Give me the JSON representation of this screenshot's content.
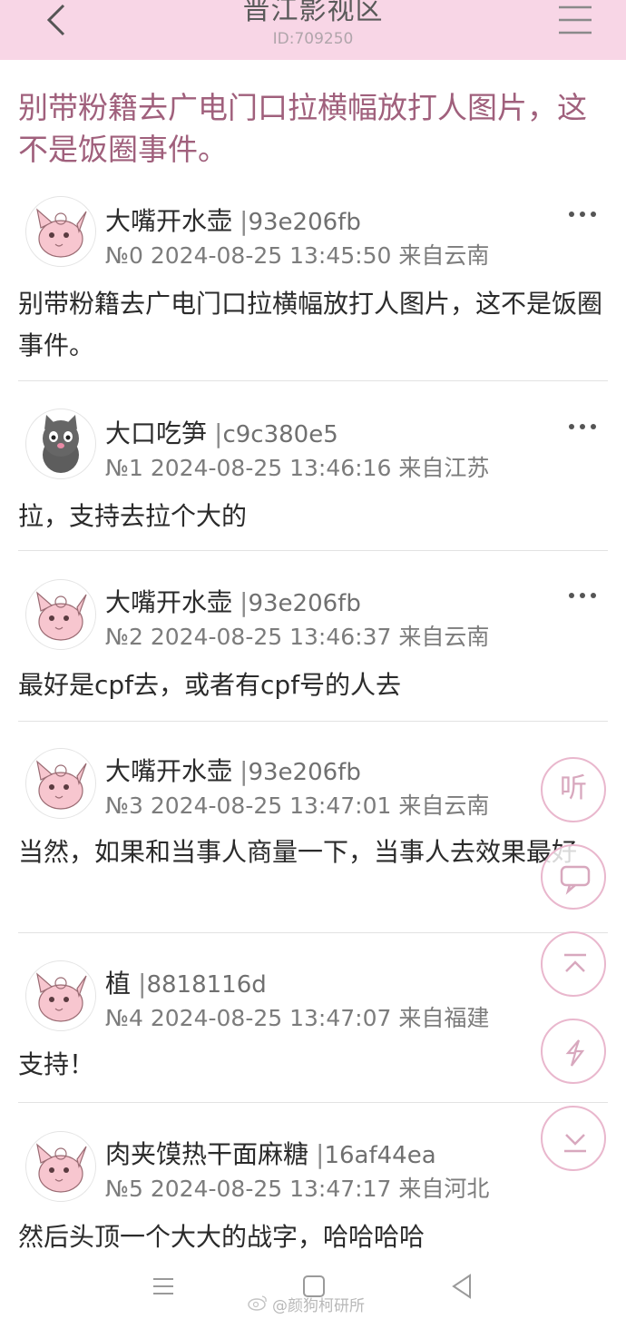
{
  "header": {
    "title": "晋江影视区",
    "id_label": "ID:709250",
    "back_icon": "chevron-left-icon",
    "menu_icon": "hamburger-menu-icon"
  },
  "thread": {
    "title": "别带粉籍去广电门口拉横幅放打人图片，这不是饭圈事件。"
  },
  "posts": [
    {
      "username": "大嘴开水壶",
      "user_id": "93e206fb",
      "floor": "№0",
      "datetime": "2024-08-25 13:45:50",
      "location": "来自云南",
      "content": "别带粉籍去广电门口拉横幅放打人图片，这不是饭圈事件。",
      "avatar": "pink-creature-avatar"
    },
    {
      "username": "大口吃笋",
      "user_id": "c9c380e5",
      "floor": "№1",
      "datetime": "2024-08-25 13:46:16",
      "location": "来自江苏",
      "content": "拉，支持去拉个大的",
      "avatar": "gray-cat-avatar"
    },
    {
      "username": "大嘴开水壶",
      "user_id": "93e206fb",
      "floor": "№2",
      "datetime": "2024-08-25 13:46:37",
      "location": "来自云南",
      "content": "最好是cpf去，或者有cpf号的人去",
      "avatar": "pink-creature-avatar"
    },
    {
      "username": "大嘴开水壶",
      "user_id": "93e206fb",
      "floor": "№3",
      "datetime": "2024-08-25 13:47:01",
      "location": "来自云南",
      "content": "当然，如果和当事人商量一下，当事人去效果最好",
      "avatar": "pink-creature-avatar"
    },
    {
      "username": "植",
      "user_id": "8818116d",
      "floor": "№4",
      "datetime": "2024-08-25 13:47:07",
      "location": "来自福建",
      "content": "支持！",
      "avatar": "pink-creature-avatar"
    },
    {
      "username": "肉夹馍热干面麻糖",
      "user_id": "16af44ea",
      "floor": "№5",
      "datetime": "2024-08-25 13:47:17",
      "location": "来自河北",
      "content": "然后头顶一个大大的战字，哈哈哈哈",
      "avatar": "pink-creature-avatar"
    }
  ],
  "floating_buttons": {
    "listen_label": "听",
    "icons": [
      "comment-icon",
      "scroll-top-icon",
      "swap-icon",
      "scroll-bottom-icon"
    ]
  },
  "watermark": {
    "text": "@颜狗柯研所"
  },
  "colors": {
    "header_bg": "#f8d6e6",
    "title_color": "#a0607c",
    "fab_border": "#e9b7cd"
  }
}
